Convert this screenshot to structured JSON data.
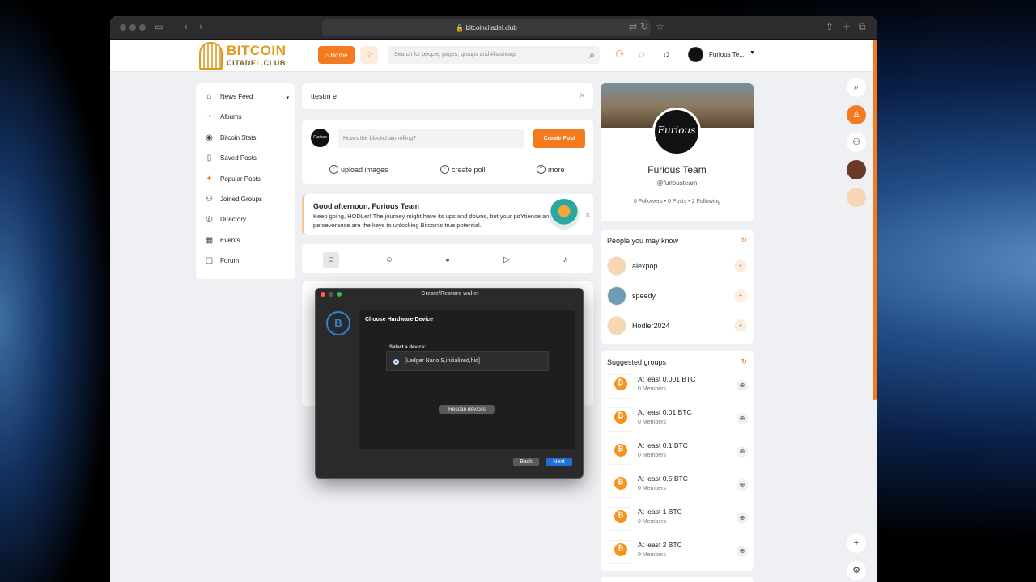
{
  "browser": {
    "url": "bitcoincitadel.club"
  },
  "site": {
    "logo_line1": "BITCOIN",
    "logo_line2": "CITADEL.CLUB",
    "home_label": "Home",
    "search_placeholder": "Search for people, pages, groups and #hashtags",
    "user_name": "Furious Te..."
  },
  "left_nav": [
    {
      "label": "News Feed",
      "icon": "home-icon"
    },
    {
      "label": "Albums",
      "icon": "album-icon"
    },
    {
      "label": "Bitcoin Stats",
      "icon": "bitcoin-icon"
    },
    {
      "label": "Saved Posts",
      "icon": "bookmark-icon"
    },
    {
      "label": "Popular Posts",
      "icon": "sparkle-icon"
    },
    {
      "label": "Joined Groups",
      "icon": "group-icon"
    },
    {
      "label": "Directory",
      "icon": "compass-icon"
    },
    {
      "label": "Events",
      "icon": "calendar-icon"
    },
    {
      "label": "Forum",
      "icon": "chat-icon"
    }
  ],
  "feed": {
    "search_value": "ttestm e",
    "compose_placeholder": "How's the blockchain rolling?",
    "create_post": "Create Post",
    "compose_avatar_text": "Furious",
    "actions": [
      "upload images",
      "create poll",
      "more"
    ],
    "greeting_title": "Good afternoon, Furious Team",
    "greeting_message": "Keep going, HODLer! The journey might have its ups and downs, but your pɑYtience and perseverance are the keys to unlocking Bitcoin's true potential."
  },
  "profile": {
    "avatar_text": "Furious",
    "name": "Furious Team",
    "handle": "@furiousteam",
    "stats": "0 Followers • 0 Posts • 2 Following"
  },
  "people": {
    "title": "People you may know",
    "items": [
      "alexpop",
      "speedy",
      "Hodler2024"
    ]
  },
  "groups": {
    "title": "Suggested groups",
    "items": [
      {
        "name": "At least 0.001 BTC",
        "members": "0 Members"
      },
      {
        "name": "At least 0.01 BTC",
        "members": "0 Members"
      },
      {
        "name": "At least 0.1 BTC",
        "members": "0 Members"
      },
      {
        "name": "At least 0.5 BTC",
        "members": "0 Members"
      },
      {
        "name": "At least 1 BTC",
        "members": "0 Members"
      },
      {
        "name": "At least 2 BTC",
        "members": "0 Members"
      }
    ]
  },
  "dialog": {
    "title": "Create/Restore wallet",
    "heading": "Choose Hardware Device",
    "select_label": "Select a device:",
    "device": "[Ledger Nano S,initialized,hid]",
    "rescan": "Rescan devices",
    "back": "Back",
    "next": "Next"
  },
  "colors": {
    "accent": "#f47a1f",
    "bitcoin": "#f7931a",
    "dialog_primary": "#1f6fd8"
  }
}
